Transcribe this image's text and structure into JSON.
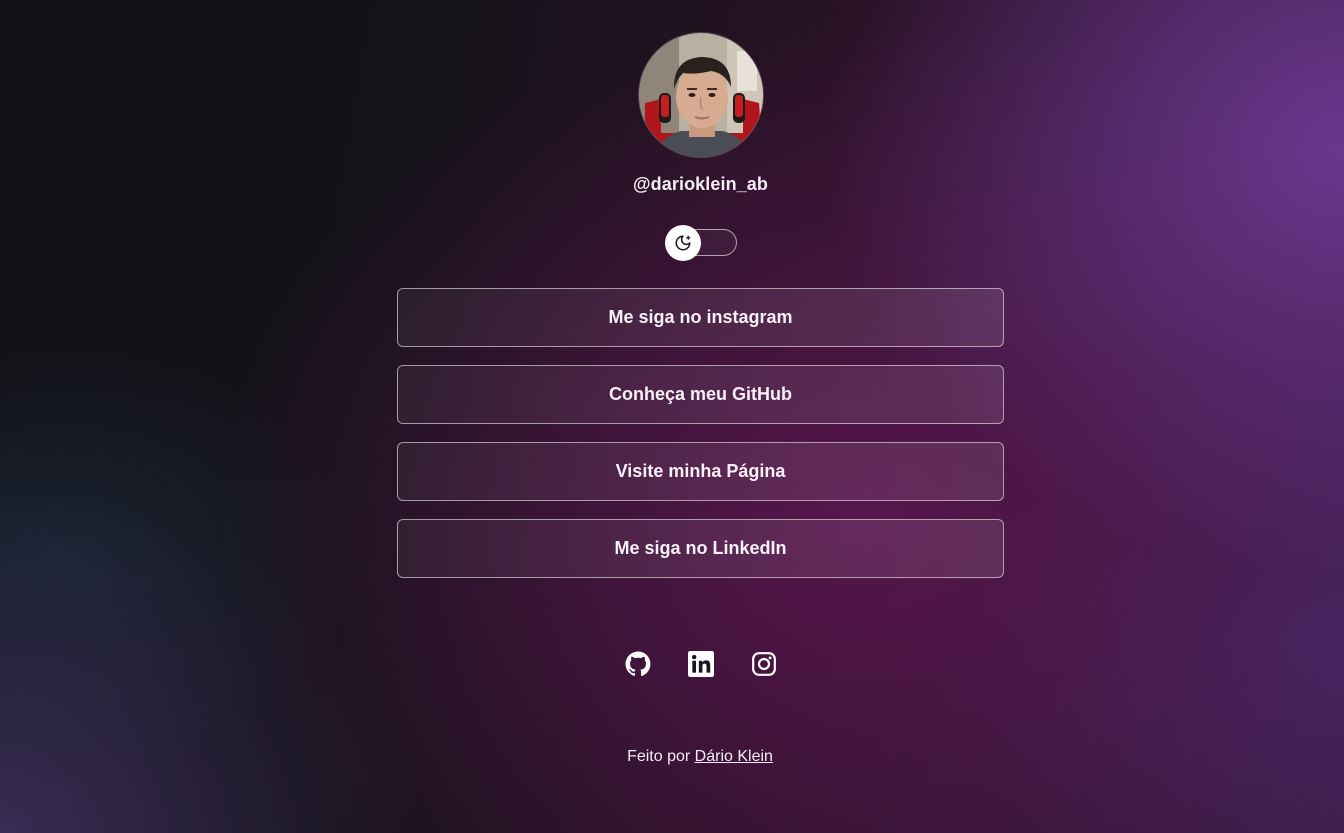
{
  "profile": {
    "username": "@darioklein_ab",
    "avatar_alt": "avatar"
  },
  "theme_toggle": {
    "icon": "moon-stars-icon",
    "state": "dark"
  },
  "links": [
    {
      "label": "Me siga no instagram"
    },
    {
      "label": "Conheça meu GitHub"
    },
    {
      "label": "Visite minha Página"
    },
    {
      "label": "Me siga no LinkedIn"
    }
  ],
  "social_icons": [
    "github-icon",
    "linkedin-icon",
    "instagram-icon"
  ],
  "footer": {
    "prefix": "Feito por",
    "author": "Dário Klein"
  },
  "colors": {
    "text": "#f3eef6",
    "accent_purple": "#703a96",
    "accent_magenta": "#5c1652",
    "base": "#121115"
  }
}
